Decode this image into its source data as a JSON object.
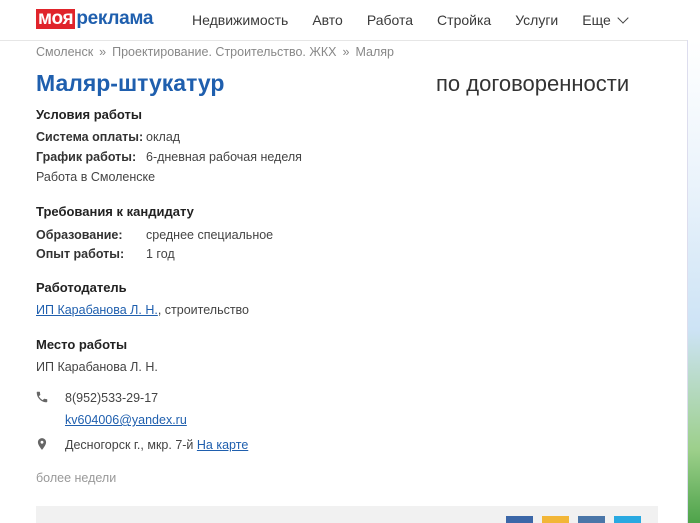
{
  "header": {
    "logo_part1": "моя",
    "logo_part2": "реклама",
    "nav": [
      "Недвижимость",
      "Авто",
      "Работа",
      "Стройка",
      "Услуги"
    ],
    "more_label": "Еще"
  },
  "breadcrumbs": [
    "Смоленск",
    "Проектирование. Строительство. ЖКХ",
    "Маляр"
  ],
  "breadcrumb_sep": "»",
  "job": {
    "title": "Маляр-штукатур",
    "salary": "по договоренности"
  },
  "conditions": {
    "heading": "Условия работы",
    "payment_label": "Система оплаты:",
    "payment_value": "оклад",
    "schedule_label": "График работы:",
    "schedule_value": "6-дневная рабочая неделя",
    "city_text": "Работа в Смоленске"
  },
  "requirements": {
    "heading": "Требования к кандидату",
    "education_label": "Образование:",
    "education_value": "среднее специальное",
    "experience_label": "Опыт работы:",
    "experience_value": "1 год"
  },
  "employer": {
    "heading": "Работодатель",
    "name_link": "ИП Карабанова Л. Н.",
    "industry": ", строительство"
  },
  "workplace": {
    "heading": "Место работы",
    "company": "ИП Карабанова Л. Н.",
    "phone": "8(952)533-29-17",
    "email": "kv604006@yandex.ru",
    "address": "Десногорск г., мкр. 7-й",
    "map_link": "На карте"
  },
  "posted": "более недели",
  "colors": {
    "brand_red": "#e0242b",
    "brand_blue": "#1f5fae",
    "social": [
      "#3b67a8",
      "#f2b637",
      "#4a76a8",
      "#29a9e1"
    ]
  }
}
